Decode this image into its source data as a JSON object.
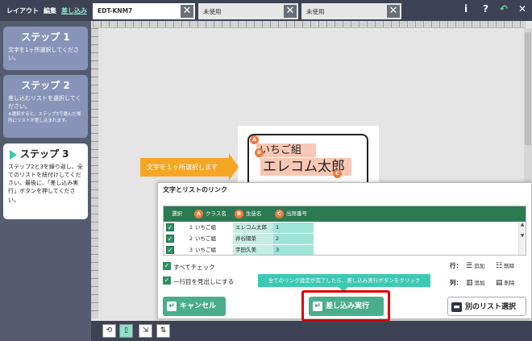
{
  "nav": {
    "layout": "レイアウト",
    "edit": "編集",
    "merge": "差し込み"
  },
  "tabs": [
    {
      "label": "EDT-KNM7"
    },
    {
      "label": "未使用"
    },
    {
      "label": "未使用"
    }
  ],
  "toolbar": {
    "info": "i",
    "help": "?",
    "undo_icon": "undo-arrow-icon",
    "close_icon": "close-icon"
  },
  "steps": [
    {
      "title": "ステップ 1",
      "text": "文字を1ヶ所選択してください。"
    },
    {
      "title": "ステップ 2",
      "text": "差し込むリストを選択してください。",
      "note": "※選択すると、ステップ3で選んだ場所にリストが差し込まれます。"
    },
    {
      "title": "ステップ 3",
      "text": "ステップ2と3を繰り返し、全てのリストを紐付けしてください。最後に、「差し込み実行」ボタンを押してください。"
    }
  ],
  "canvas": {
    "tooltip": "文字を１ヶ所選択します",
    "field_a_text": "いちご組",
    "field_b_text": "エレコム太郎",
    "badge_a": "A",
    "badge_b": "B",
    "badge_c": "C"
  },
  "dialog": {
    "title": "文字とリストのリンク",
    "columns": [
      {
        "badge": "",
        "label": "選択"
      },
      {
        "badge": "A",
        "label": "クラス名"
      },
      {
        "badge": "B",
        "label": "生徒名"
      },
      {
        "badge": "C",
        "label": "出席番号"
      }
    ],
    "rows": [
      {
        "num": "1",
        "class": "いちご組",
        "name": "エレコム太郎",
        "seat": "1"
      },
      {
        "num": "2",
        "class": "いちご組",
        "name": "井谷陽菜",
        "seat": "2"
      },
      {
        "num": "3",
        "class": "いちご組",
        "name": "宇田久美",
        "seat": "3"
      }
    ],
    "check_all": "すべてチェック",
    "first_row_heading": "一行目を見出しにする",
    "row_label": "行：",
    "col_label": "列：",
    "add": "追加",
    "delete": "削除",
    "hint": "全てのリンク設定が完了したら、差し込み実行ボタンをクリック",
    "cancel_label": "キャンセル",
    "exec_label": "差し込み実行",
    "other_list_label": "別のリスト選択"
  },
  "colors": {
    "accent": "#4aae8c",
    "header": "#2c7a52",
    "highlight": "#e00000",
    "badge": "#f07a3c",
    "tooltip": "#f5a623"
  }
}
